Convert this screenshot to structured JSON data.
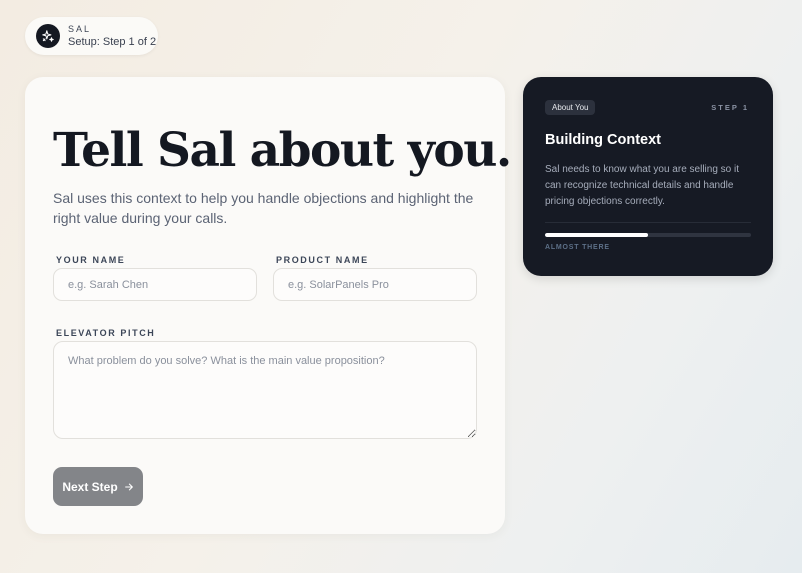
{
  "brand": {
    "name": "SAL",
    "step_text": "Setup: Step 1 of 2",
    "logo_icon": "sparkles-icon"
  },
  "main": {
    "headline": "Tell Sal about you.",
    "subtitle": "Sal uses this context to help you handle objections and highlight the right value during your calls.",
    "fields": {
      "your_name": {
        "label": "YOUR NAME",
        "placeholder": "e.g. Sarah Chen",
        "value": ""
      },
      "product_name": {
        "label": "PRODUCT NAME",
        "placeholder": "e.g. SolarPanels Pro",
        "value": ""
      },
      "elevator_pitch": {
        "label": "ELEVATOR PITCH",
        "placeholder": "What problem do you solve? What is the main value proposition?",
        "value": ""
      }
    },
    "next_button": {
      "label": "Next Step",
      "icon": "arrow-right-icon"
    }
  },
  "side_panel": {
    "badge": "About You",
    "step_label": "STEP 1",
    "title": "Building Context",
    "description": "Sal needs to know what you are selling so it can recognize technical details and handle pricing objections correctly.",
    "progress_fraction": 0.5,
    "status": "ALMOST THERE"
  },
  "colors": {
    "accent_dark": "#161a24",
    "button_gray": "#838589",
    "card_bg": "#fbfaf8"
  }
}
